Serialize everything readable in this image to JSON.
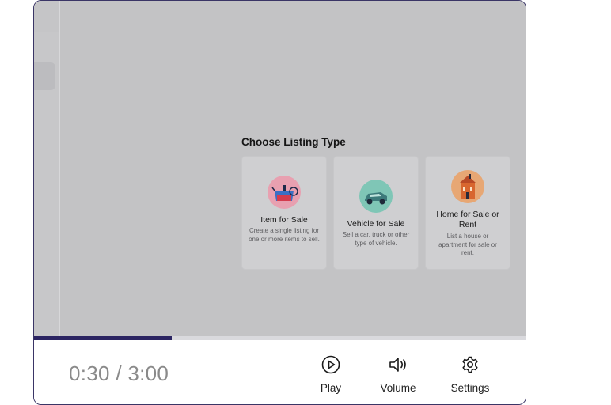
{
  "modal": {
    "title": "Choose Listing Type",
    "cards": [
      {
        "title": "Item for Sale",
        "description": "Create a single listing for one or more items to sell.",
        "icon": "item-sale-icon"
      },
      {
        "title": "Vehicle for Sale",
        "description": "Sell a car, truck or other type of vehicle.",
        "icon": "vehicle-icon"
      },
      {
        "title": "Home for Sale or Rent",
        "description": "List a house or apartment for sale or rent.",
        "icon": "house-icon"
      }
    ]
  },
  "player": {
    "time": "0:30 / 3:00",
    "progress": 0.28,
    "play_label": "Play",
    "volume_label": "Volume",
    "settings_label": "Settings"
  },
  "colors": {
    "accent": "#2b2462",
    "overlay": "#c3c3c5",
    "item_icon_bg": "#e8a0b0",
    "vehicle_icon_bg": "#7fc6b6",
    "house_icon_bg": "#e7a774"
  }
}
